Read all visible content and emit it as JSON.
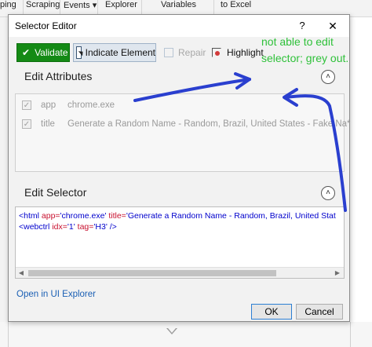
{
  "background_app": {
    "ribbon_items": [
      "ping",
      "Scraping",
      "Events",
      "Explorer",
      "Variables",
      "to Excel"
    ],
    "events_dropdown": "▾"
  },
  "dialog": {
    "title": "Selector Editor",
    "help_label": "?",
    "close_label": "✕"
  },
  "toolbar": {
    "validate_label": "Validate",
    "indicate_label": "Indicate Element",
    "repair_label": "Repair",
    "highlight_label": "Highlight"
  },
  "edit_attributes": {
    "title": "Edit Attributes",
    "collapse_icon": "˄",
    "rows": [
      {
        "name": "app",
        "value": "chrome.exe",
        "checked": true
      },
      {
        "name": "title",
        "value": "Generate a Random Name - Random, Brazil, United States - Fake Na*",
        "checked": true
      }
    ]
  },
  "edit_selector": {
    "title": "Edit Selector",
    "collapse_icon": "˄",
    "line1": {
      "open": "<html ",
      "attr1": "app=",
      "val1": "'chrome.exe'",
      "space": " ",
      "attr2": "title=",
      "val2": "'Generate a Random Name - Random, Brazil, United Stat"
    },
    "line2": {
      "open": "<webctrl ",
      "attr1": "idx=",
      "val1": "'1'",
      "space": " ",
      "attr2": "tag=",
      "val2": "'H3'",
      "close": " />"
    }
  },
  "footer": {
    "open_in_explorer": "Open in UI Explorer",
    "ok_label": "OK",
    "cancel_label": "Cancel"
  },
  "annotation": {
    "line1": "not able to edit",
    "line2": "selector; grey out.",
    "color": "#2fc13a",
    "arrow_color": "#2a3fcf"
  },
  "colors": {
    "validate_green": "#148a15",
    "link_blue": "#1a5fb4",
    "tag_blue": "#0000cc",
    "attr_red": "#c8102e"
  }
}
